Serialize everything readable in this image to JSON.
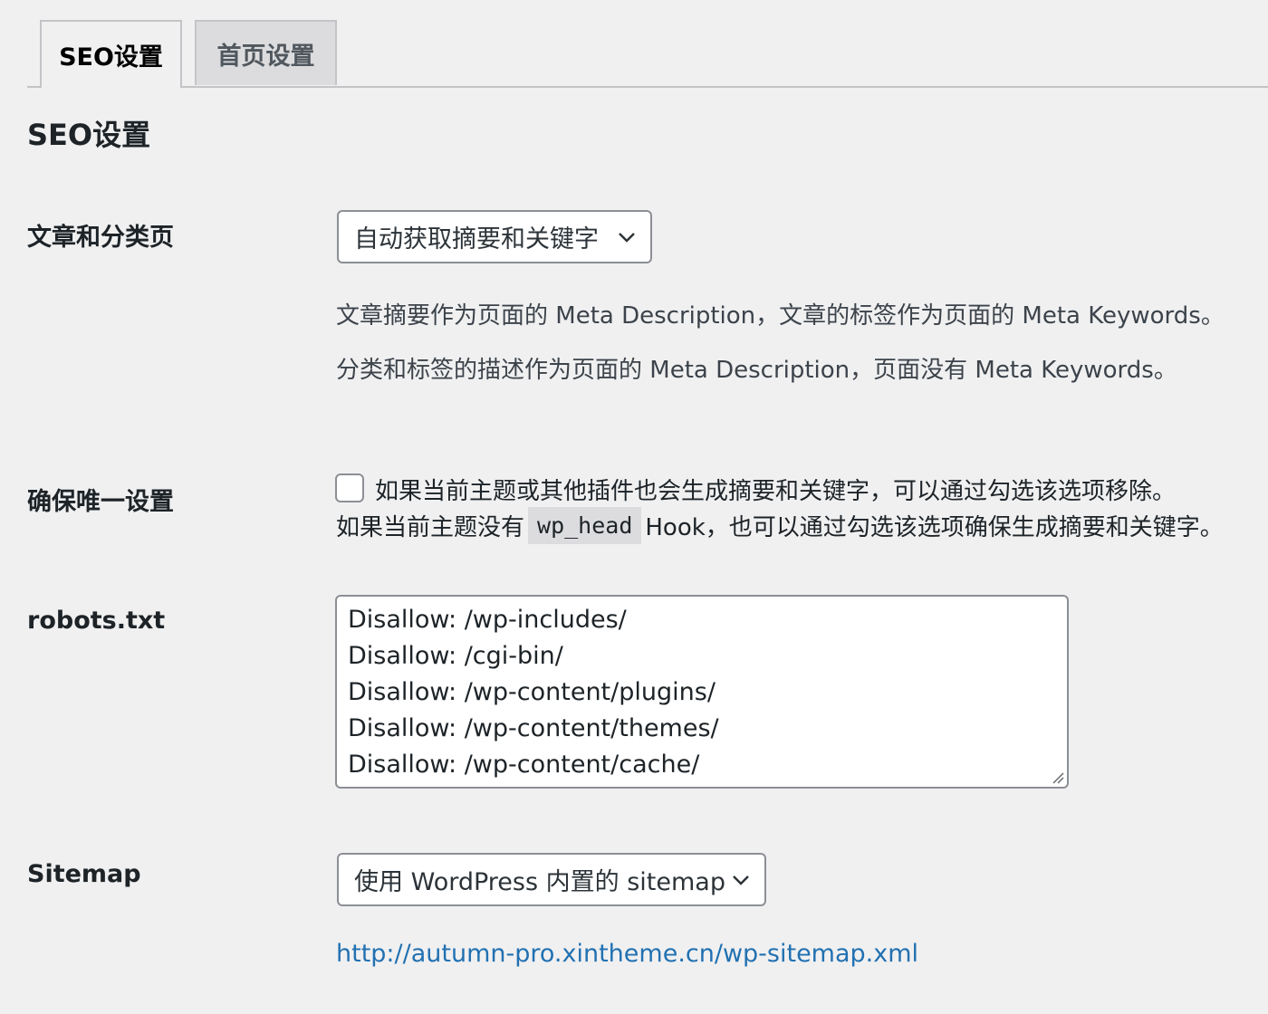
{
  "tabs": [
    {
      "label": "SEO设置",
      "active": true
    },
    {
      "label": "首页设置",
      "active": false
    }
  ],
  "section_title": "SEO设置",
  "rows": {
    "article": {
      "label": "文章和分类页",
      "select_value": "自动获取摘要和关键字",
      "desc1": "文章摘要作为页面的 Meta Description，文章的标签作为页面的 Meta Keywords。",
      "desc2": "分类和标签的描述作为页面的 Meta Description，页面没有 Meta Keywords。"
    },
    "unique": {
      "label": "确保唯一设置",
      "checked": false,
      "text1": "如果当前主题或其他插件也会生成摘要和关键字，可以通过勾选该选项移除。",
      "text2_prefix": "如果当前主题没有",
      "code": "wp_head",
      "text2_suffix": "Hook，也可以通过勾选该选项确保生成摘要和关键字。"
    },
    "robots": {
      "label": "robots.txt",
      "lines": [
        "Disallow: /wp-includes/",
        "Disallow: /cgi-bin/",
        "Disallow: /wp-content/plugins/",
        "Disallow: /wp-content/themes/",
        "Disallow: /wp-content/cache/"
      ]
    },
    "sitemap": {
      "label": "Sitemap",
      "select_value": "使用 WordPress 内置的 sitemap",
      "link": "http://autumn-pro.xintheme.cn/wp-sitemap.xml"
    }
  },
  "colors": {
    "background": "#f0f0f1",
    "link": "#2271b1",
    "border": "#8c8f94"
  }
}
